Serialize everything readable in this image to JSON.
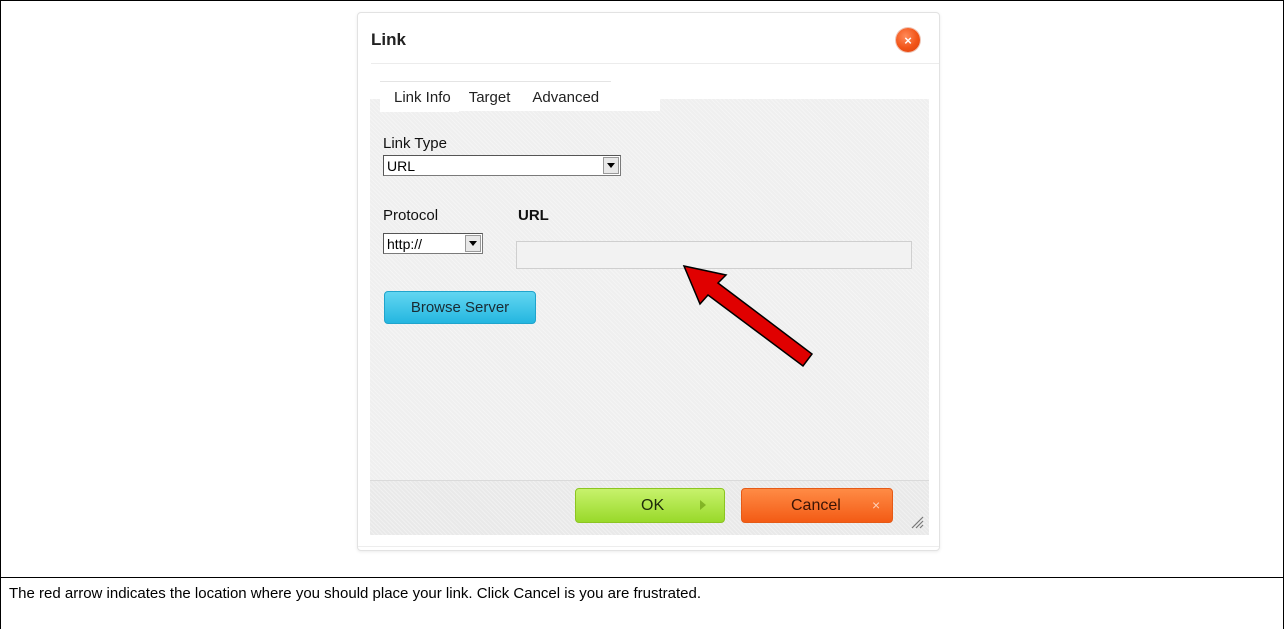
{
  "dialog": {
    "title": "Link",
    "close_icon": "close-icon",
    "tabs": [
      {
        "label": "Link Info",
        "active": true
      },
      {
        "label": "Target",
        "active": false
      },
      {
        "label": "Advanced",
        "active": false
      }
    ],
    "link_type": {
      "label": "Link Type",
      "value": "URL"
    },
    "protocol": {
      "label": "Protocol",
      "value": "http://"
    },
    "url": {
      "label": "URL",
      "value": ""
    },
    "browse_label": "Browse Server",
    "ok_label": "OK",
    "cancel_label": "Cancel",
    "cancel_icon_glyph": "×"
  },
  "annotation": {
    "arrow_color": "#e00000",
    "caption": "The red arrow indicates the location where you should place your link.  Click Cancel is you are frustrated."
  }
}
